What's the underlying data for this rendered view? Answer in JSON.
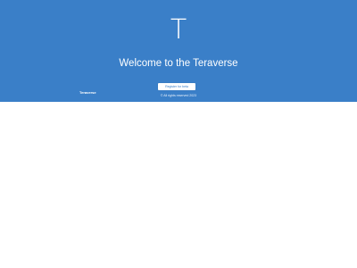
{
  "hero": {
    "logo_letter": "T",
    "title": "Welcome to the Teraverse",
    "brand_name": "Teraverse",
    "register_button_label": "Register for beta",
    "copyright": "© All rights reserved 2023",
    "background_color": "#3a7fc8",
    "text_color": "#ffffff"
  }
}
